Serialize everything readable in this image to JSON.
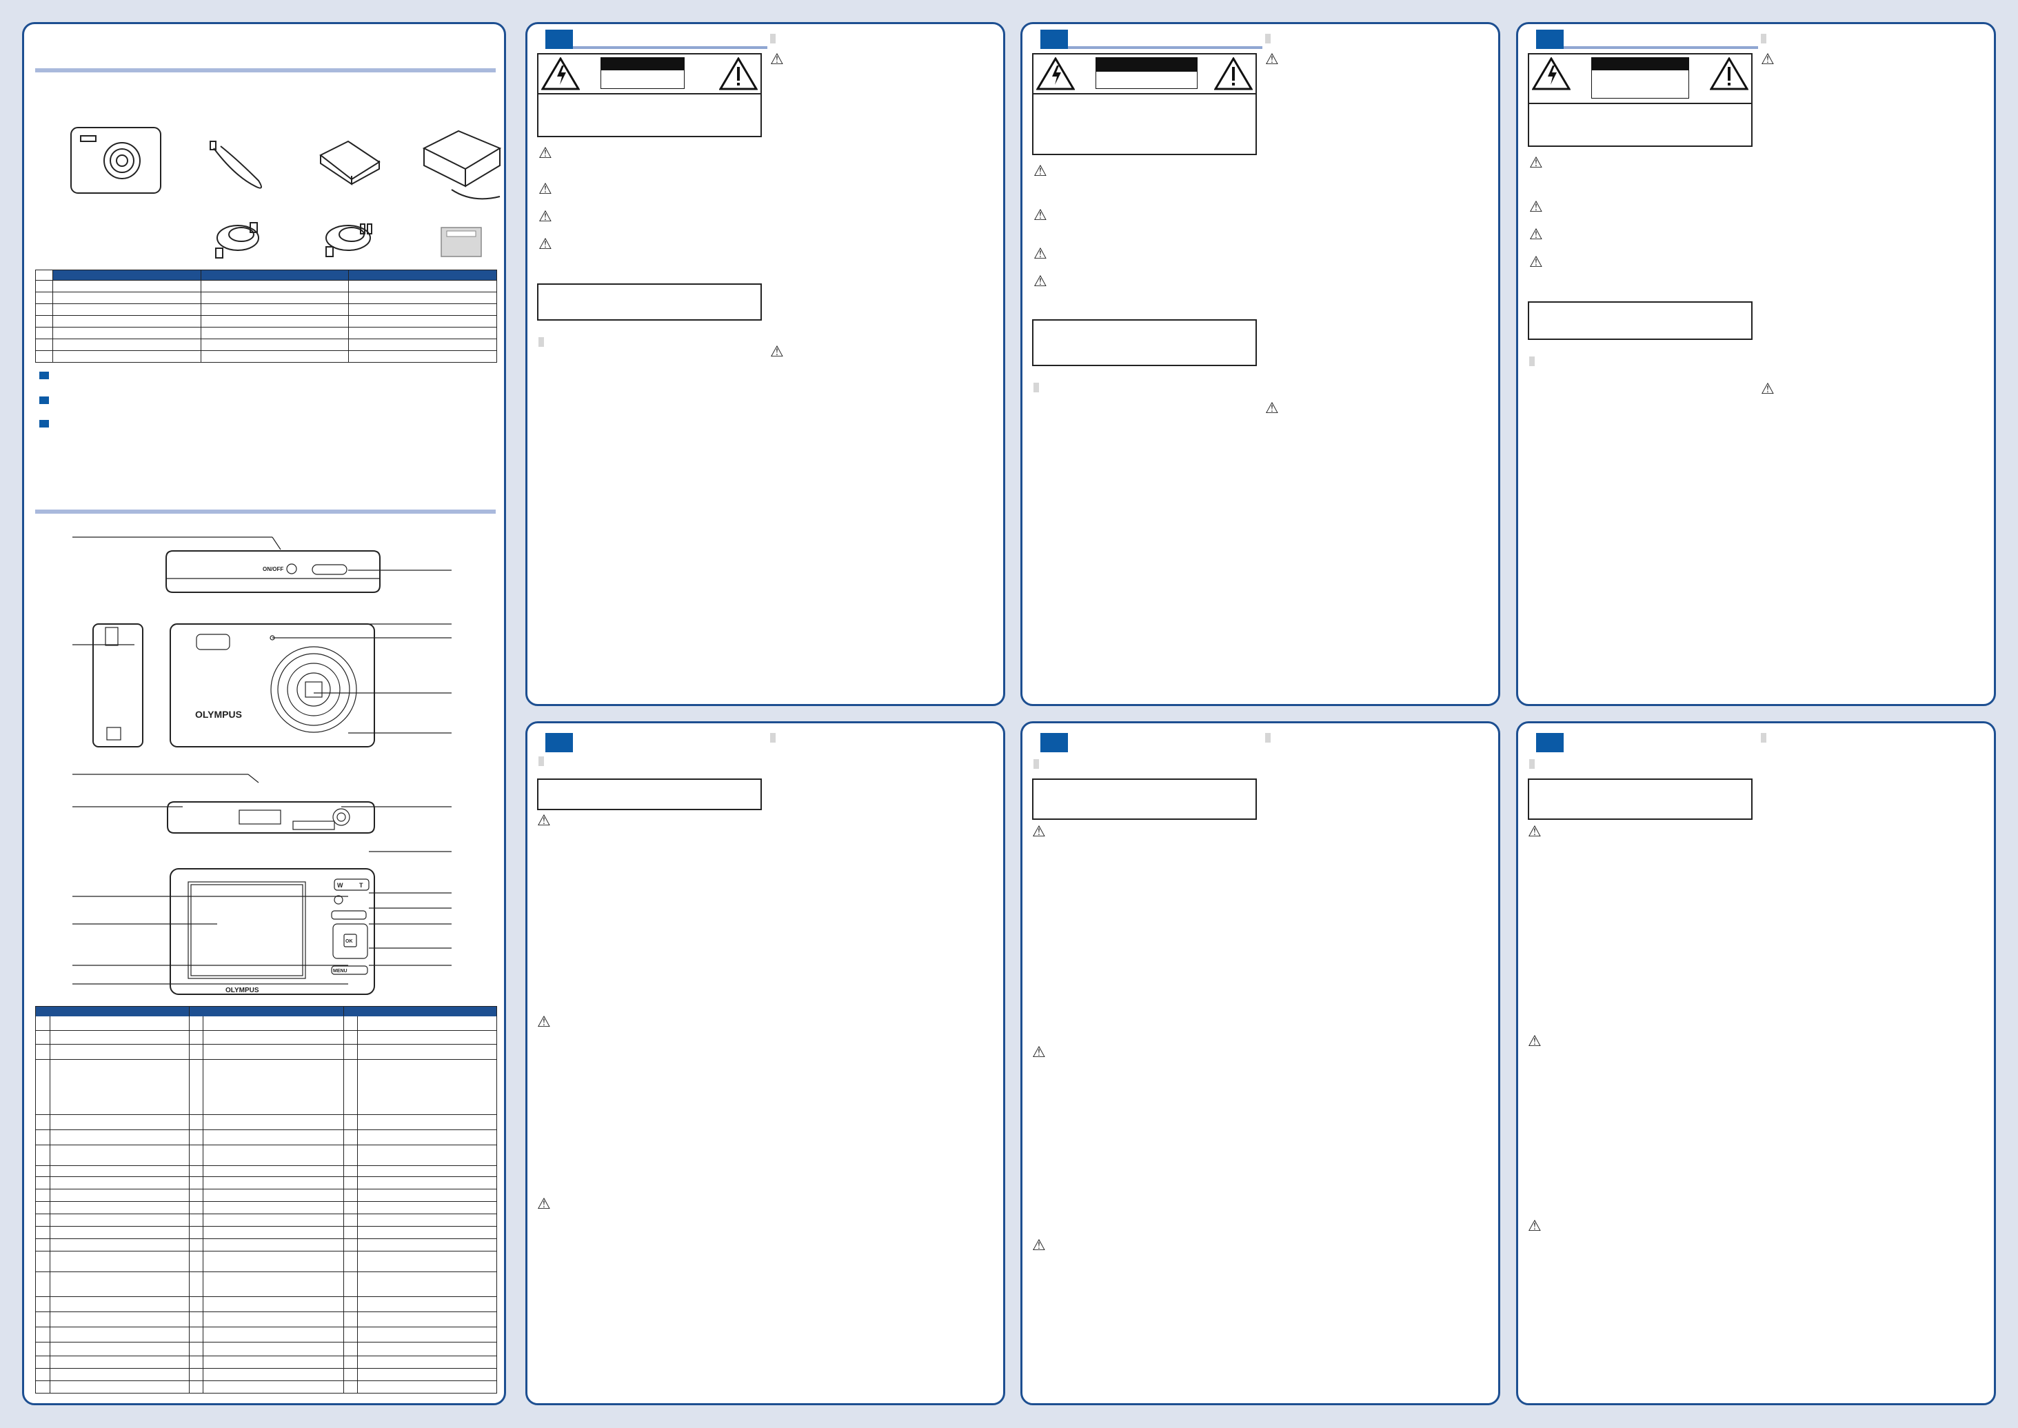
{
  "accessories": {
    "items": [
      "camera",
      "strap",
      "battery",
      "battery-charger",
      "usb-cable",
      "av-cable",
      "cd-rom"
    ],
    "table_rows": 7
  },
  "camera_diagram": {
    "brand_label": "OLYMPUS",
    "onoff_label": "ON/OFF",
    "w_label": "W",
    "t_label": "T",
    "menu_label": "MENU",
    "ok_label": "OK"
  },
  "parts_table": {
    "rows": 32
  },
  "colors": {
    "page_bg": "#dde3ee",
    "panel_border": "#1d4f91",
    "accent": "#0b5aa6",
    "rule": "#a9b9dc"
  }
}
